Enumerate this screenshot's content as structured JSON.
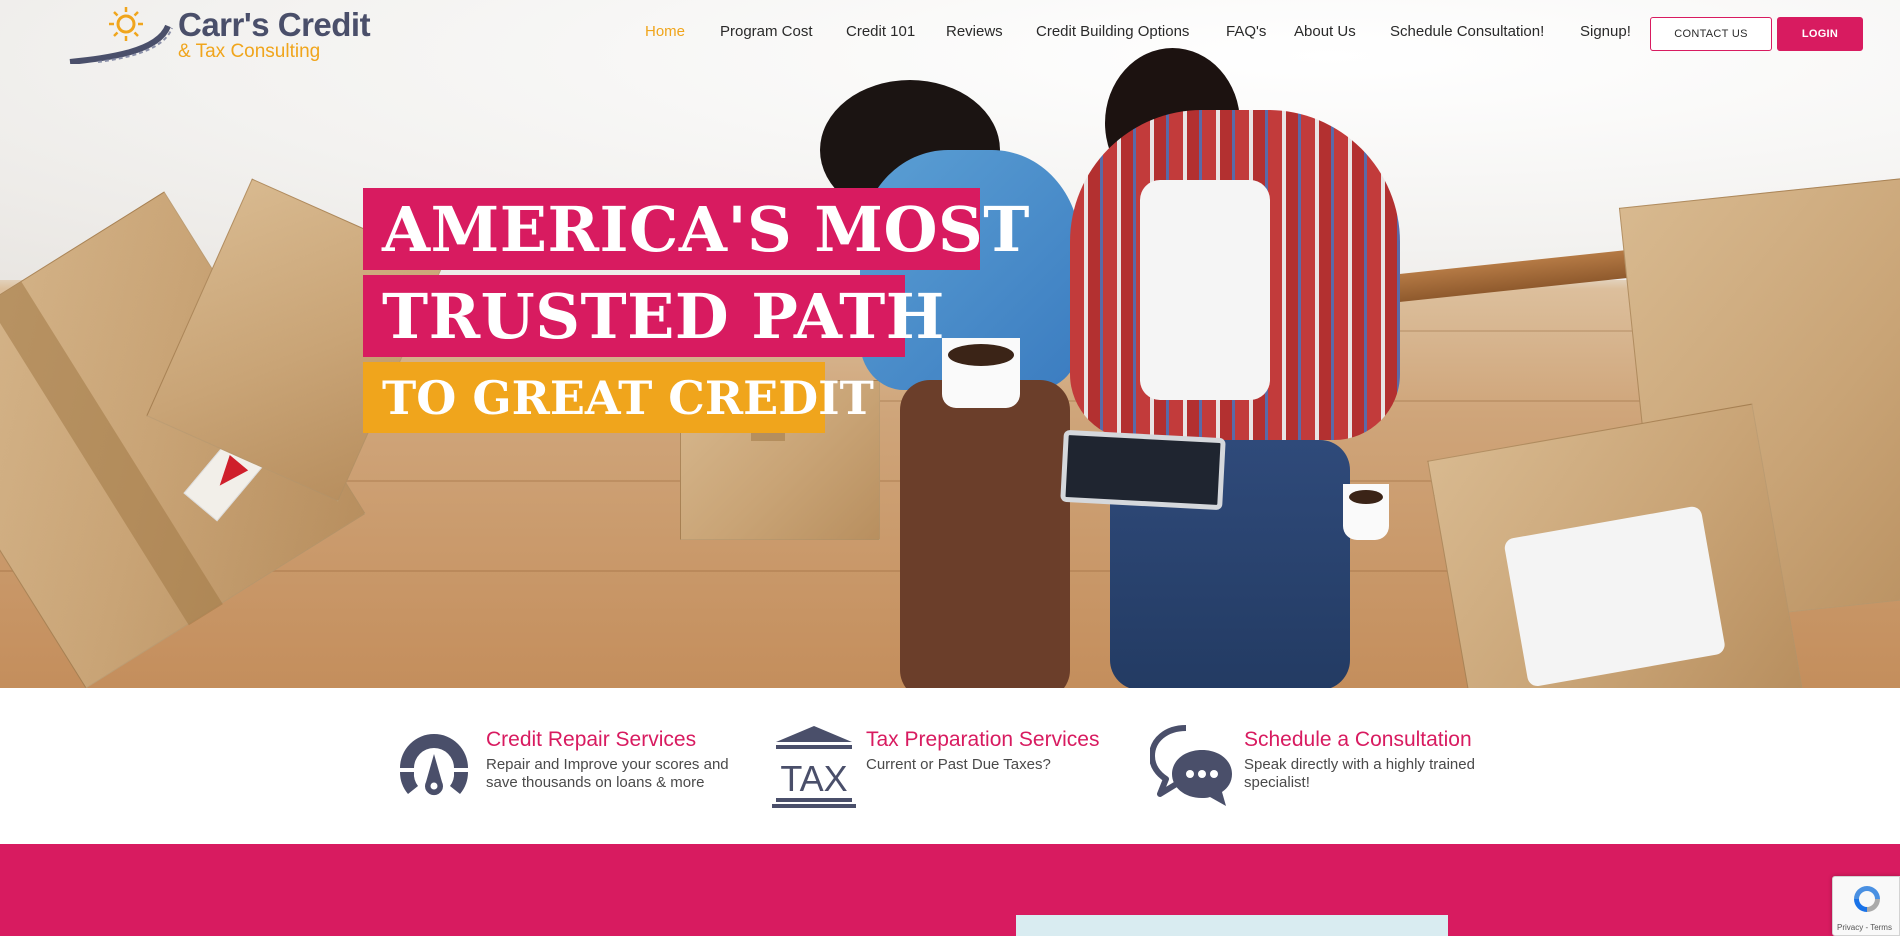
{
  "brand": {
    "name": "Carr's Credit",
    "tagline": "& Tax Consulting"
  },
  "nav": {
    "items": [
      {
        "label": "Home",
        "active": true
      },
      {
        "label": "Program Cost"
      },
      {
        "label": "Credit 101"
      },
      {
        "label": "Reviews"
      },
      {
        "label": "Credit Building Options"
      },
      {
        "label": "FAQ's"
      },
      {
        "label": "About Us"
      },
      {
        "label": "Schedule Consultation!"
      },
      {
        "label": "Signup!"
      }
    ],
    "contact_label": "CONTACT US",
    "login_label": "LOGIN"
  },
  "hero": {
    "line1": "AMERICA'S MOST",
    "line2": "TRUSTED PATH",
    "line3": "TO GREAT CREDIT"
  },
  "features": [
    {
      "icon": "gauge-icon",
      "title": "Credit Repair Services",
      "description": "Repair and Improve your scores and save thousands on loans & more"
    },
    {
      "icon": "tax-building-icon",
      "title": "Tax Preparation Services",
      "description": "Current or Past Due Taxes?"
    },
    {
      "icon": "chat-bubbles-icon",
      "title": "Schedule a Consultation",
      "description": "Speak directly with a highly trained specialist!"
    }
  ],
  "icon_text": {
    "tax": "TAX"
  },
  "recaptcha": {
    "footer": "Privacy - Terms"
  },
  "colors": {
    "primary": "#d81b60",
    "accent": "#f0a51c",
    "icon": "#4a4f6a"
  }
}
